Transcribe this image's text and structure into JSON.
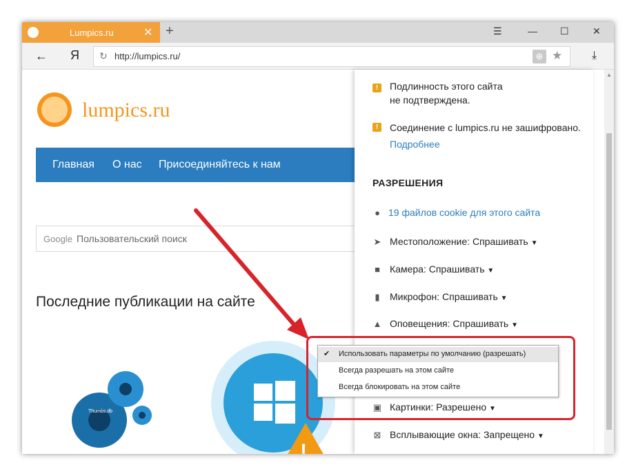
{
  "browser": {
    "tab_title": "Lumpics.ru",
    "new_tab_icon": "+",
    "window_controls": {
      "menu": "☰",
      "minimize": "—",
      "maximize": "☐",
      "close": "✕"
    },
    "logo_letter": "Я",
    "url": "http://lumpics.ru/"
  },
  "page": {
    "logo_text": "lumpics.ru",
    "nav": [
      "Главная",
      "О нас",
      "Присоединяйтесь к нам"
    ],
    "search_brand": "Google",
    "search_placeholder": "Пользовательский поиск",
    "heading": "Последние публикации на сайте",
    "gears_caption": "Thumbs.db"
  },
  "site_info": {
    "auth_warning_line1": "Подлинность этого сайта",
    "auth_warning_line2": "не подтверждена.",
    "conn_warning": "Соединение с lumpics.ru не зашифровано.",
    "more_link": "Подробнее",
    "permissions_header": "РАЗРЕШЕНИЯ",
    "cookies_link": "19 файлов cookie для этого сайта",
    "permissions": [
      {
        "label": "Местоположение:",
        "value": "Спрашивать"
      },
      {
        "label": "Камера:",
        "value": "Спрашивать"
      },
      {
        "label": "Микрофон:",
        "value": "Спрашивать"
      },
      {
        "label": "Оповещения:",
        "value": "Спрашивать"
      },
      {
        "label": "Картинки:",
        "value": "Разрешено"
      },
      {
        "label": "Всплывающие окна:",
        "value": "Запрещено"
      }
    ]
  },
  "dropdown": {
    "items": [
      "Использовать параметры по умолчанию (разрешать)",
      "Всегда разрешать на этом сайте",
      "Всегда блокировать на этом сайте"
    ],
    "selected_index": 0
  },
  "colors": {
    "accent_orange": "#f3a13a",
    "nav_blue": "#2b7dbf",
    "highlight_red": "#d8232a"
  }
}
